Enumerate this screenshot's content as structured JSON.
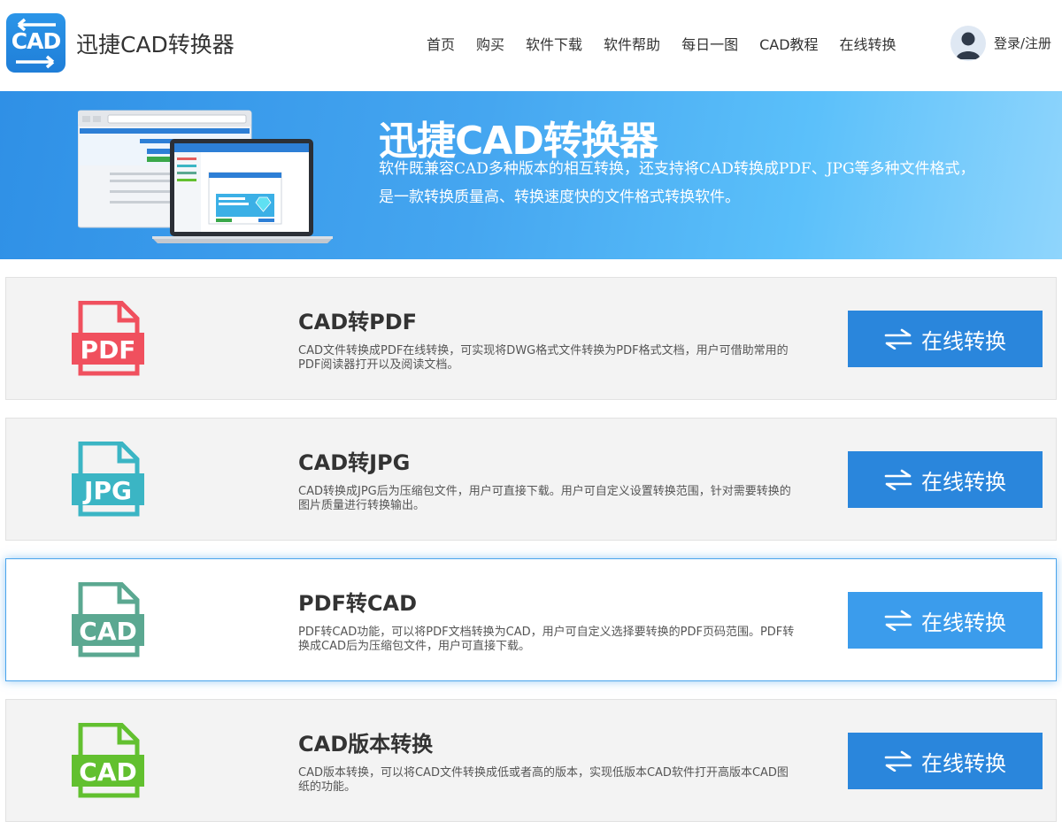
{
  "header": {
    "logo_text": "CAD",
    "brand": "迅捷CAD转换器",
    "nav": [
      {
        "label": "首页"
      },
      {
        "label": "购买"
      },
      {
        "label": "软件下载"
      },
      {
        "label": "软件帮助"
      },
      {
        "label": "每日一图"
      },
      {
        "label": "CAD教程"
      },
      {
        "label": "在线转换"
      }
    ],
    "login": "登录/注册"
  },
  "banner": {
    "title": "迅捷CAD转换器",
    "description": "软件既兼容CAD多种版本的相互转换，还支持将CAD转换成PDF、JPG等多种文件格式，是一款转换质量高、转换速度快的文件格式转换软件。"
  },
  "cards": [
    {
      "icon_label": "PDF",
      "icon_color": "#f0505e",
      "title": "CAD转PDF",
      "description": "CAD文件转换成PDF在线转换，可实现将DWG格式文件转换为PDF格式文档，用户可借助常用的PDF阅读器打开以及阅读文档。",
      "button": "在线转换",
      "active": false
    },
    {
      "icon_label": "JPG",
      "icon_color": "#3bb5c4",
      "title": "CAD转JPG",
      "description": "CAD转换成JPG后为压缩包文件，用户可直接下载。用户可自定义设置转换范围，针对需要转换的图片质量进行转换输出。",
      "button": "在线转换",
      "active": false
    },
    {
      "icon_label": "CAD",
      "icon_color": "#5ba891",
      "title": "PDF转CAD",
      "description": "PDF转CAD功能，可以将PDF文档转换为CAD，用户可自定义选择要转换的PDF页码范围。PDF转换成CAD后为压缩包文件，用户可直接下载。",
      "button": "在线转换",
      "active": true
    },
    {
      "icon_label": "CAD",
      "icon_color": "#62c02f",
      "title": "CAD版本转换",
      "description": "CAD版本转换，可以将CAD文件转换成低或者高的版本，实现低版本CAD软件打开高版本CAD图纸的功能。",
      "button": "在线转换",
      "active": false
    }
  ],
  "colors": {
    "primary_button": "#2a86dc",
    "banner_start": "#2f90e6",
    "banner_end": "#8fd5fc"
  }
}
